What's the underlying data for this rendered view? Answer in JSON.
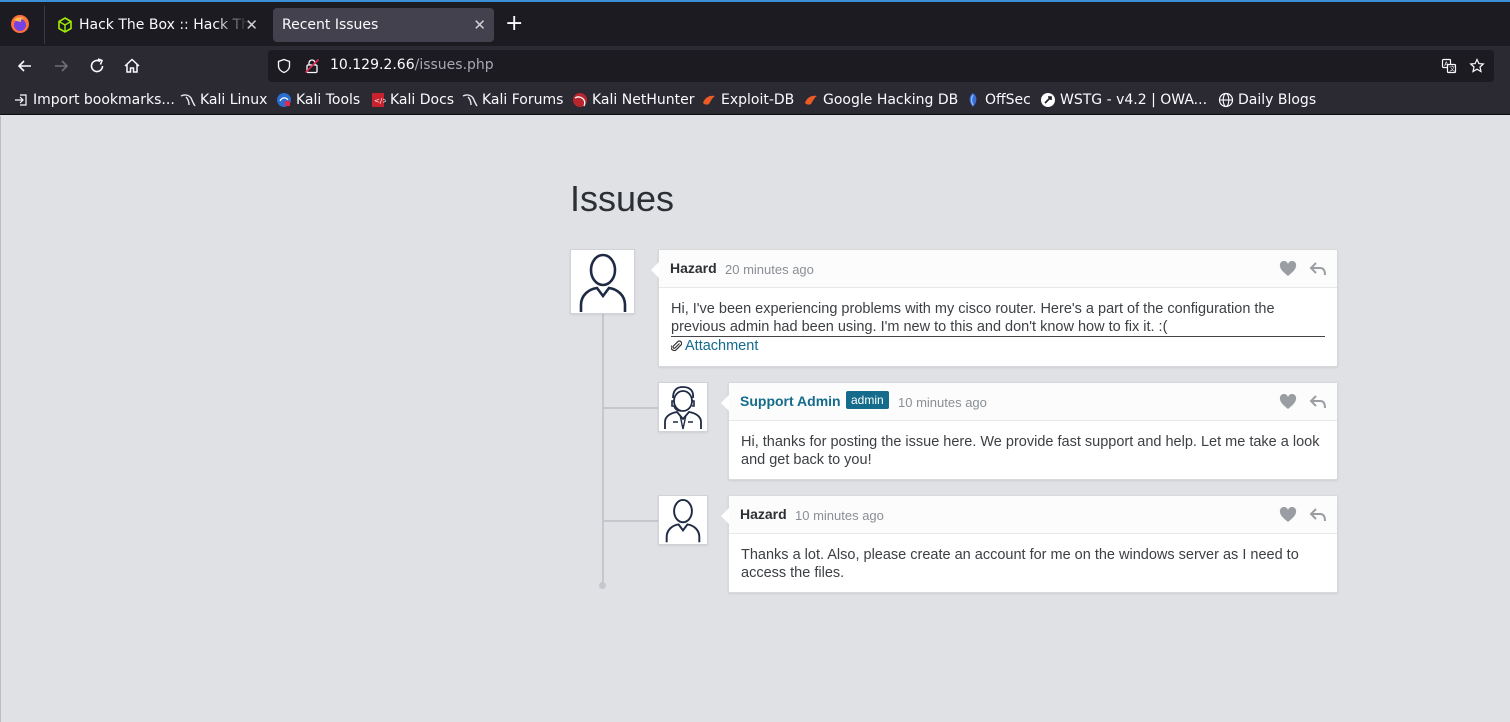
{
  "browser": {
    "tabs": [
      {
        "title": "Hack The Box :: Hack The Box",
        "active": false
      },
      {
        "title": "Recent Issues",
        "active": true
      }
    ],
    "url": {
      "host": "10.129.2.66",
      "path": "/issues.php"
    },
    "bookmarks": [
      {
        "label": "Import bookmarks...",
        "icon": "import-icon"
      },
      {
        "label": "Kali Linux",
        "icon": "kali-dragon-icon"
      },
      {
        "label": "Kali Tools",
        "icon": "kali-tools-icon"
      },
      {
        "label": "Kali Docs",
        "icon": "kali-docs-icon"
      },
      {
        "label": "Kali Forums",
        "icon": "kali-dragon-icon"
      },
      {
        "label": "Kali NetHunter",
        "icon": "nethunter-icon"
      },
      {
        "label": "Exploit-DB",
        "icon": "exploitdb-icon"
      },
      {
        "label": "Google Hacking DB",
        "icon": "exploitdb-icon"
      },
      {
        "label": "OffSec",
        "icon": "offsec-icon"
      },
      {
        "label": "WSTG - v4.2 | OWA...",
        "icon": "owasp-icon"
      },
      {
        "label": "Daily Blogs",
        "icon": "globe-icon"
      }
    ]
  },
  "page": {
    "title": "Issues",
    "posts": [
      {
        "author": "Hazard",
        "time": "20 minutes ago",
        "body": "Hi, I've been experiencing problems with my cisco router. Here's a part of the configuration the previous admin had been using. I'm new to this and don't know how to fix it. :(",
        "attachment": "Attachment"
      },
      {
        "author": "Support Admin",
        "badge": "admin",
        "time": "10 minutes ago",
        "body": "Hi, thanks for posting the issue here. We provide fast support and help. Let me take a look and get back to you!"
      },
      {
        "author": "Hazard",
        "time": "10 minutes ago",
        "body": "Thanks a lot. Also, please create an account for me on the windows server as I need to access the files."
      }
    ]
  },
  "colors": {
    "accent": "#146b8c",
    "page_bg": "#dfe1e4",
    "chrome_bg": "#2b2a33"
  }
}
